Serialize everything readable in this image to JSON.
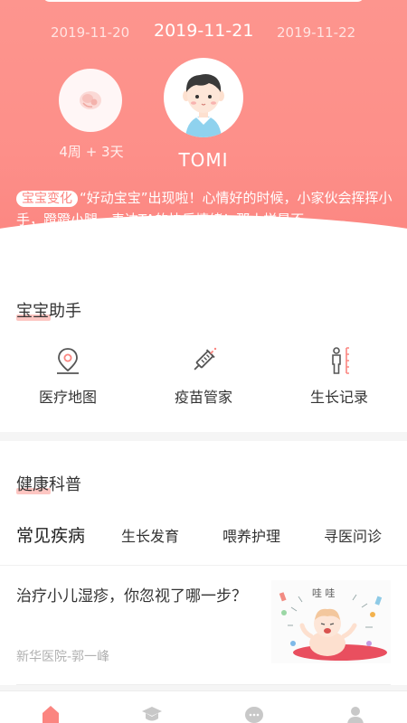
{
  "header": {
    "dates": {
      "prev": "2019-11-20",
      "current": "2019-11-21",
      "next": "2019-11-22"
    },
    "fetus": {
      "icon": "fetus-icon",
      "week_label": "4周 + 3天"
    },
    "baby": {
      "avatar_icon": "baby-avatar",
      "name": "TOMI"
    },
    "change": {
      "badge": "宝宝变化",
      "text": "“好动宝宝”出现啦！心情好的时候，小家伙会挥挥小手，蹬蹬小腿，表达TA的快乐情绪！那小样是不..."
    }
  },
  "assistant": {
    "title": "宝宝助手",
    "tools": [
      {
        "label": "医疗地图",
        "icon": "location-pin-icon"
      },
      {
        "label": "疫苗管家",
        "icon": "syringe-icon"
      },
      {
        "label": "生长记录",
        "icon": "height-ruler-icon"
      }
    ]
  },
  "health": {
    "title": "健康科普",
    "tabs": [
      {
        "label": "常见疾病",
        "active": true
      },
      {
        "label": "生长发育",
        "active": false
      },
      {
        "label": "喂养护理",
        "active": false
      },
      {
        "label": "寻医问诊",
        "active": false
      }
    ],
    "articles": [
      {
        "title": "治疗小儿湿疹，你忽视了哪一步？",
        "source": "新华医院-郭一峰",
        "image_text": "哇 哇"
      }
    ]
  },
  "bottom_nav": {
    "items": [
      {
        "icon": "home-icon",
        "active": true
      },
      {
        "icon": "graduation-cap-icon",
        "active": false
      },
      {
        "icon": "chat-bubble-icon",
        "active": false
      },
      {
        "icon": "person-icon",
        "active": false
      }
    ]
  },
  "colors": {
    "accent": "#fd8f89",
    "highlight": "#fdc6c2",
    "icon_gray": "#c8c8c8",
    "text": "#333333"
  }
}
